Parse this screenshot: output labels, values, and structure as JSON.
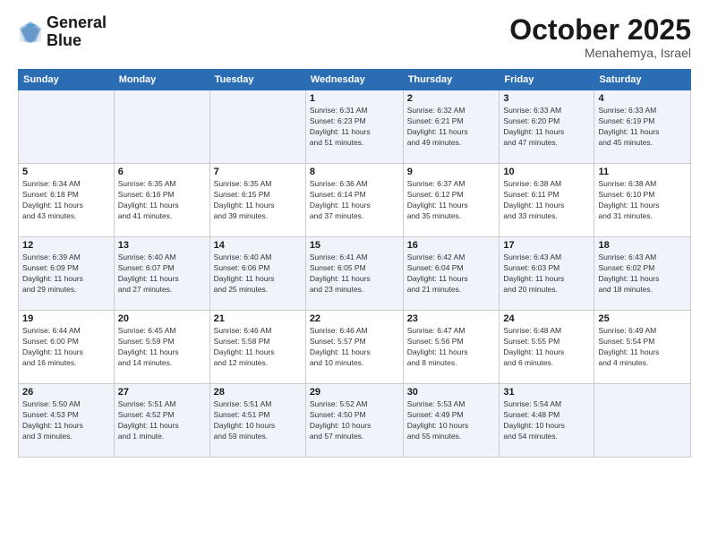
{
  "header": {
    "logo_line1": "General",
    "logo_line2": "Blue",
    "month": "October 2025",
    "location": "Menahemya, Israel"
  },
  "weekdays": [
    "Sunday",
    "Monday",
    "Tuesday",
    "Wednesday",
    "Thursday",
    "Friday",
    "Saturday"
  ],
  "weeks": [
    [
      {
        "day": "",
        "info": ""
      },
      {
        "day": "",
        "info": ""
      },
      {
        "day": "",
        "info": ""
      },
      {
        "day": "1",
        "info": "Sunrise: 6:31 AM\nSunset: 6:23 PM\nDaylight: 11 hours\nand 51 minutes."
      },
      {
        "day": "2",
        "info": "Sunrise: 6:32 AM\nSunset: 6:21 PM\nDaylight: 11 hours\nand 49 minutes."
      },
      {
        "day": "3",
        "info": "Sunrise: 6:33 AM\nSunset: 6:20 PM\nDaylight: 11 hours\nand 47 minutes."
      },
      {
        "day": "4",
        "info": "Sunrise: 6:33 AM\nSunset: 6:19 PM\nDaylight: 11 hours\nand 45 minutes."
      }
    ],
    [
      {
        "day": "5",
        "info": "Sunrise: 6:34 AM\nSunset: 6:18 PM\nDaylight: 11 hours\nand 43 minutes."
      },
      {
        "day": "6",
        "info": "Sunrise: 6:35 AM\nSunset: 6:16 PM\nDaylight: 11 hours\nand 41 minutes."
      },
      {
        "day": "7",
        "info": "Sunrise: 6:35 AM\nSunset: 6:15 PM\nDaylight: 11 hours\nand 39 minutes."
      },
      {
        "day": "8",
        "info": "Sunrise: 6:36 AM\nSunset: 6:14 PM\nDaylight: 11 hours\nand 37 minutes."
      },
      {
        "day": "9",
        "info": "Sunrise: 6:37 AM\nSunset: 6:12 PM\nDaylight: 11 hours\nand 35 minutes."
      },
      {
        "day": "10",
        "info": "Sunrise: 6:38 AM\nSunset: 6:11 PM\nDaylight: 11 hours\nand 33 minutes."
      },
      {
        "day": "11",
        "info": "Sunrise: 6:38 AM\nSunset: 6:10 PM\nDaylight: 11 hours\nand 31 minutes."
      }
    ],
    [
      {
        "day": "12",
        "info": "Sunrise: 6:39 AM\nSunset: 6:09 PM\nDaylight: 11 hours\nand 29 minutes."
      },
      {
        "day": "13",
        "info": "Sunrise: 6:40 AM\nSunset: 6:07 PM\nDaylight: 11 hours\nand 27 minutes."
      },
      {
        "day": "14",
        "info": "Sunrise: 6:40 AM\nSunset: 6:06 PM\nDaylight: 11 hours\nand 25 minutes."
      },
      {
        "day": "15",
        "info": "Sunrise: 6:41 AM\nSunset: 6:05 PM\nDaylight: 11 hours\nand 23 minutes."
      },
      {
        "day": "16",
        "info": "Sunrise: 6:42 AM\nSunset: 6:04 PM\nDaylight: 11 hours\nand 21 minutes."
      },
      {
        "day": "17",
        "info": "Sunrise: 6:43 AM\nSunset: 6:03 PM\nDaylight: 11 hours\nand 20 minutes."
      },
      {
        "day": "18",
        "info": "Sunrise: 6:43 AM\nSunset: 6:02 PM\nDaylight: 11 hours\nand 18 minutes."
      }
    ],
    [
      {
        "day": "19",
        "info": "Sunrise: 6:44 AM\nSunset: 6:00 PM\nDaylight: 11 hours\nand 16 minutes."
      },
      {
        "day": "20",
        "info": "Sunrise: 6:45 AM\nSunset: 5:59 PM\nDaylight: 11 hours\nand 14 minutes."
      },
      {
        "day": "21",
        "info": "Sunrise: 6:46 AM\nSunset: 5:58 PM\nDaylight: 11 hours\nand 12 minutes."
      },
      {
        "day": "22",
        "info": "Sunrise: 6:46 AM\nSunset: 5:57 PM\nDaylight: 11 hours\nand 10 minutes."
      },
      {
        "day": "23",
        "info": "Sunrise: 6:47 AM\nSunset: 5:56 PM\nDaylight: 11 hours\nand 8 minutes."
      },
      {
        "day": "24",
        "info": "Sunrise: 6:48 AM\nSunset: 5:55 PM\nDaylight: 11 hours\nand 6 minutes."
      },
      {
        "day": "25",
        "info": "Sunrise: 6:49 AM\nSunset: 5:54 PM\nDaylight: 11 hours\nand 4 minutes."
      }
    ],
    [
      {
        "day": "26",
        "info": "Sunrise: 5:50 AM\nSunset: 4:53 PM\nDaylight: 11 hours\nand 3 minutes."
      },
      {
        "day": "27",
        "info": "Sunrise: 5:51 AM\nSunset: 4:52 PM\nDaylight: 11 hours\nand 1 minute."
      },
      {
        "day": "28",
        "info": "Sunrise: 5:51 AM\nSunset: 4:51 PM\nDaylight: 10 hours\nand 59 minutes."
      },
      {
        "day": "29",
        "info": "Sunrise: 5:52 AM\nSunset: 4:50 PM\nDaylight: 10 hours\nand 57 minutes."
      },
      {
        "day": "30",
        "info": "Sunrise: 5:53 AM\nSunset: 4:49 PM\nDaylight: 10 hours\nand 55 minutes."
      },
      {
        "day": "31",
        "info": "Sunrise: 5:54 AM\nSunset: 4:48 PM\nDaylight: 10 hours\nand 54 minutes."
      },
      {
        "day": "",
        "info": ""
      }
    ]
  ]
}
